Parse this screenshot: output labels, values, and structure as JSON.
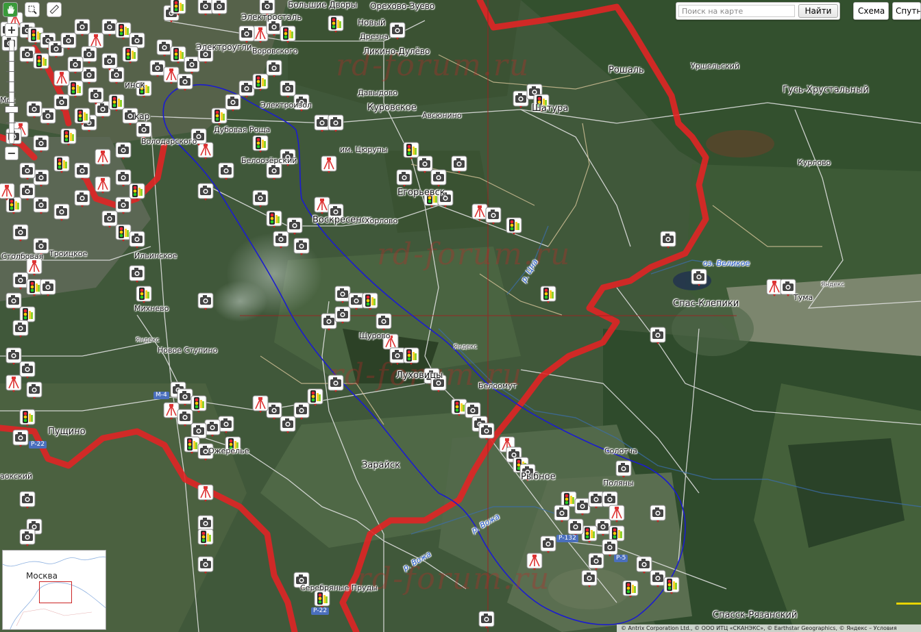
{
  "toolbar": {
    "tools": [
      {
        "name": "pan-tool",
        "icon": "hand-icon"
      },
      {
        "name": "magnifier-tool",
        "icon": "magnifier-icon"
      },
      {
        "name": "ruler-tool",
        "icon": "ruler-icon"
      }
    ],
    "zoom_in_label": "+",
    "zoom_out_label": "−"
  },
  "search": {
    "placeholder": "Поиск на карте",
    "button_label": "Найти"
  },
  "layers": {
    "scheme_label": "Схема",
    "satellite_label": "Спутник"
  },
  "minimap": {
    "city_label": "Москва"
  },
  "watermark_text": "rd-forum.ru",
  "copyright": "© Antrix Corporation Ltd., © ООО ИТЦ «СКАНЭКС», © Earthstar Geographics, © Яндекс – Условия",
  "places": {
    "orekhovo": "Орехово-Зуево",
    "bolshie_dvory": "Большие Дворы",
    "elektrostal": "Электросталь",
    "elektrougli": "Электроугли",
    "vorovskogo": "Воровского",
    "likino": "Ликино-Дулёво",
    "drezna": "Дрезна",
    "noviy": "Новый",
    "davydovo": "Давыдово",
    "kurovskoe": "Куровское",
    "avsyunino": "Авсюнино",
    "roshal": "Рошаль",
    "urshelsky": "Уршельский",
    "gus": "Гусь-Хрустальный",
    "shatura": "Шатура",
    "elektrogorsk": "Электроизол",
    "dubovaya": "Дубовая Роща",
    "belo": "Белоозёрский",
    "tsyurupy": "им. Цюрупы",
    "egorievsk": "Егорьевск",
    "khorlovo": "Хорлово",
    "voskresensk": "Воскресенск",
    "kurlovo": "Курлово",
    "lake_velikoe": "оз. Великое",
    "tsna": "р. Цна",
    "spas_klepiki": "Спас-Клепики",
    "tuma": "Тума",
    "yandex1": "Яндекс",
    "yandex2": "Яндекс",
    "yandex3": "Яндекс",
    "troitskoe": "Троицкое",
    "stolbovaya": "Столбовая",
    "ilinskoe": "Ильинское",
    "mikhnevo": "Михнево",
    "novoe_stupino": "Новое Ступино",
    "volodarskogo": "Володарского",
    "shchurovo": "Щурово",
    "lukhovitsy": "Луховицы",
    "beloomut": "Белоомут",
    "pushchino": "Пущино",
    "zaraysk": "Зарайск",
    "solotcha": "Солотча",
    "polyany": "Поляны",
    "rybnoe": "Рыбное",
    "vozha1": "р. Вожа",
    "vozha2": "р. Вожа",
    "serebryanye": "Серебряные Пруды",
    "spassk": "Спасск-Рязанский",
    "zhinsk": "инск",
    "kar": "кар",
    "ozherelye": "Ожерелье",
    "aokskiy": "аокский",
    "mos": "Мос"
  },
  "road_badges": [
    "М-4",
    "Р-132",
    "Р-22",
    "Р-22",
    "Р-5"
  ],
  "colors": {
    "region_border": "#e02525",
    "route": "#1b1bd0",
    "crosshair": "#a02020"
  }
}
